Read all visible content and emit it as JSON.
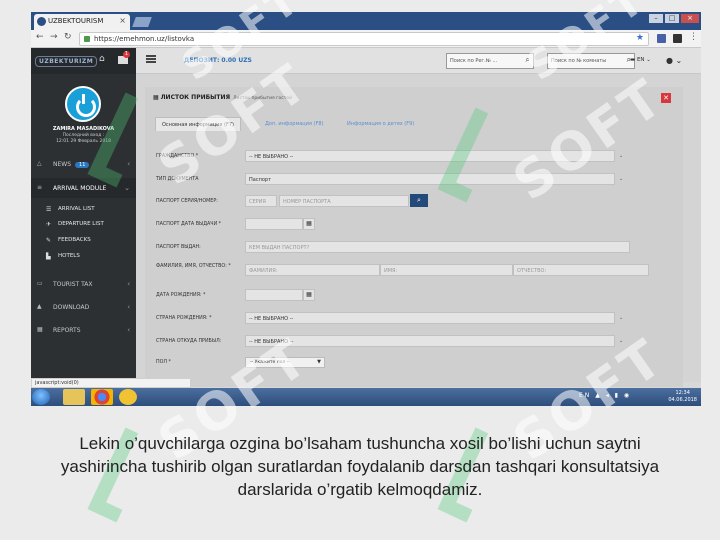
{
  "browser": {
    "tab_title": "UZBEKTOURISM",
    "url": "https://emehmon.uz/listovka",
    "ext_badge": "16"
  },
  "sidebar": {
    "logo": "UZBEKTURIZM",
    "mail_count": "1",
    "user_name": "ZAMIRA MASADIKOVA",
    "user_role": "Последний вход :",
    "user_last_login": "12:01 29 Февраль 2018",
    "menu": {
      "news": {
        "label": "NEWS",
        "badge": "11"
      },
      "arrival": {
        "label": "ARRIVAL MODULE"
      },
      "arrival_list": "ARRIVAL LIST",
      "departure_list": "DEPARTURE LIST",
      "feedbacks": "FEEDBACKS",
      "hotels": "HOTELS",
      "tourist_tax": "TOURIST TAX",
      "download": "DOWNLOAD",
      "reports": "REPORTS"
    },
    "bottom_box": "Техник масалалар бўйича"
  },
  "topbar": {
    "deposit": "ДЕПОЗИТ: 0.00 UZS",
    "search_reg_placeholder": "Поиск по Рег.№ ...",
    "search_room_placeholder": "Поиск по № комнаты",
    "lang": "EN"
  },
  "form": {
    "title": "ЛИСТОК ПРИБЫТИЯ",
    "subtitle": "Листок прибытия гостей",
    "tabs": [
      "Основная информация (F7)",
      "Доп. информация (F8)",
      "Информация о детях (F9)"
    ],
    "labels": {
      "citizenship": "ГРАЖДАНСТВО *",
      "doc_type": "ТИП ДОКУМЕНТА",
      "passport_number": "ПАСПОРТ СЕРИЯ/НОМЕР:",
      "passport_date": "ПАСПОРТ ДАТА ВЫДАЧИ *",
      "passport_issued": "ПАСПОРТ ВЫДАН:",
      "full_name": "ФАМИЛИЯ, ИМЯ, ОТЧЕСТВО: *",
      "birth_date": "ДАТА РОЖДЕНИЯ: *",
      "birth_country": "СТРАНА РОЖДЕНИЯ: *",
      "arrival_country": "СТРАНА ОТКУДА ПРИБЫЛ:",
      "sex": "ПОЛ *"
    },
    "values": {
      "citizenship": "-- НЕ ВЫБРАНО --",
      "doc_type": "Паспорт",
      "birth_country": "-- НЕ ВЫБРАНО --",
      "arrival_country": "-- НЕ ВЫБРАНО --",
      "sex": "-- Укажите пол --"
    },
    "placeholders": {
      "series": "СЕРИЯ",
      "passport_number": "НОМЕР ПАСПОРТА",
      "issued_by": "КЕМ ВЫДАН ПАСПОРТ?",
      "surname": "ФАМИЛИЯ:",
      "name": "ИМЯ:",
      "patronymic": "ОТЧЕСТВО:"
    }
  },
  "statusbar": "javascript:void(0)",
  "taskbar": {
    "lang": "EN",
    "time": "12:34",
    "date": "04.06.2018"
  },
  "watermark": "SOFT",
  "caption": "Lekin o’quvchilarga ozgina bo’lsaham tushuncha xosil bo’lishi uchun saytni yashirincha tushirib olgan suratlardan foydalanib darsdan tashqari konsultatsiya darslarida o’rgatib kelmoqdamiz."
}
